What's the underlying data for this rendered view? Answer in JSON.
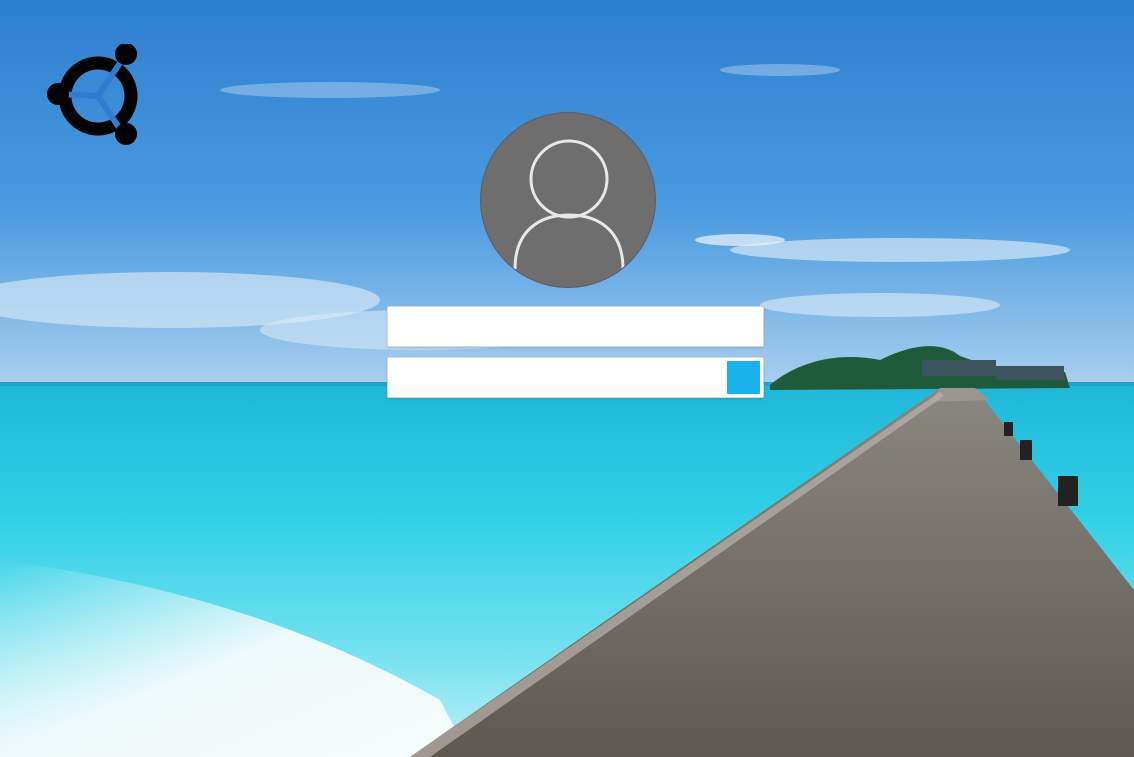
{
  "login": {
    "username": {
      "value": "",
      "placeholder": ""
    },
    "password": {
      "value": "",
      "placeholder": ""
    },
    "submit_button": {
      "label": "",
      "color": "#18b3ee"
    }
  },
  "branding": {
    "logo_icon": "ubuntu-circle-of-friends-icon",
    "logo_color": "#000000"
  },
  "user": {
    "avatar_icon": "user-silhouette-icon",
    "avatar_bg": "#6e6e6e"
  },
  "wallpaper": {
    "scene": "tropical-beach-pier",
    "sky_color": "#3b8fd6",
    "sea_color": "#27c9e2",
    "sand_color": "#eaf6f8",
    "pier_color": "#6f6a64"
  }
}
